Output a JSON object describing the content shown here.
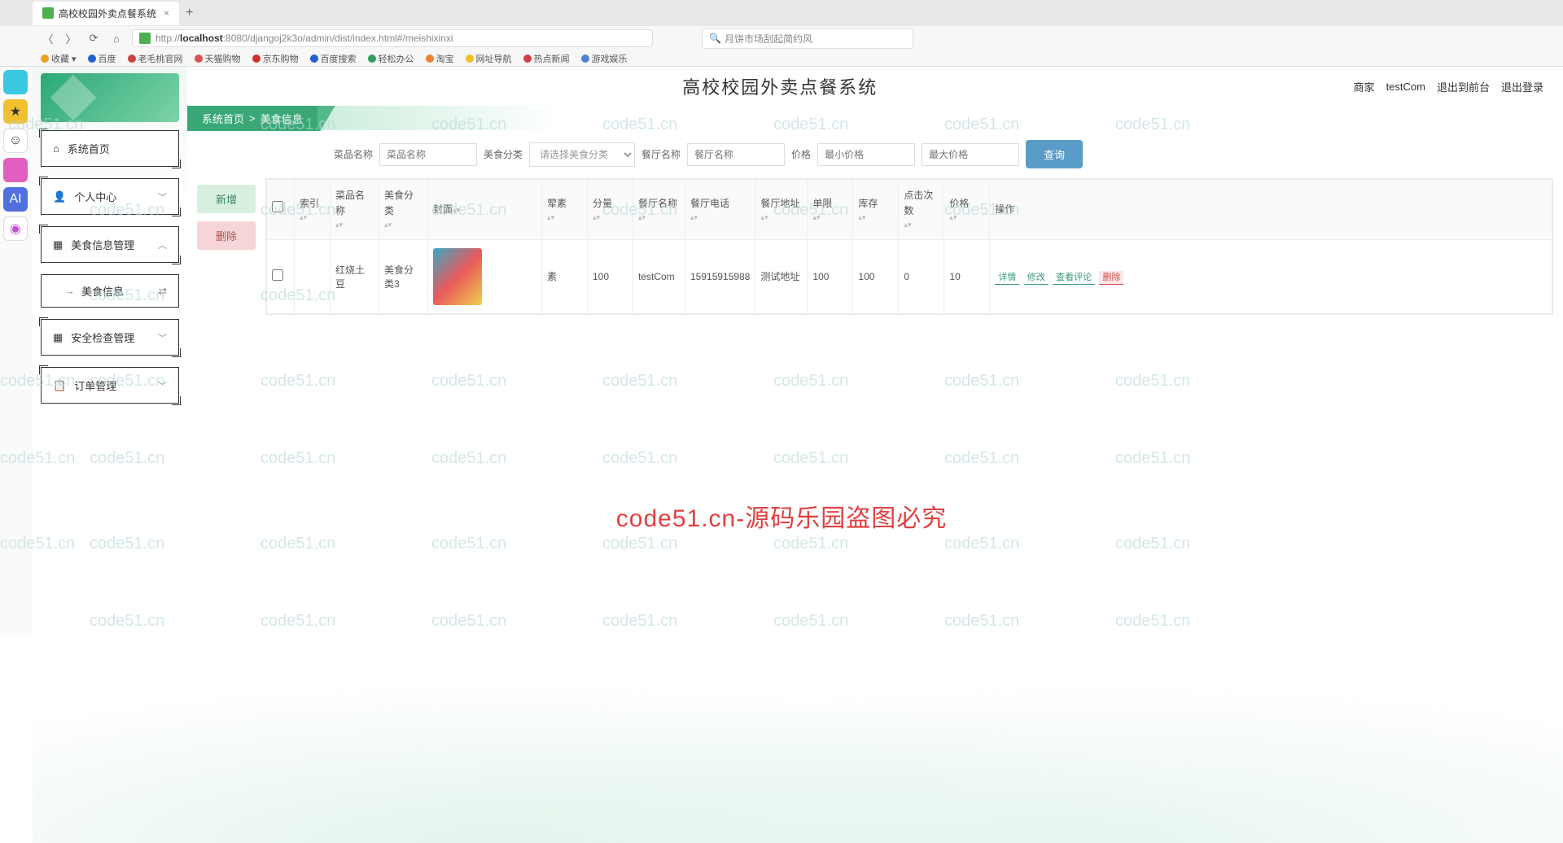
{
  "browser": {
    "tab_title": "高校校园外卖点餐系统",
    "url_prefix": "http://",
    "url_host": "localhost",
    "url_rest": ":8080/djangoj2k3o/admin/dist/index.html#/meishixinxi",
    "search_placeholder": "月饼市场刮起简约风",
    "bookmarks": [
      "收藏",
      "百度",
      "老毛桃官网",
      "天猫购物",
      "京东购物",
      "百度搜索",
      "轻松办公",
      "淘宝",
      "网址导航",
      "热点新闻",
      "游戏娱乐"
    ]
  },
  "header": {
    "title": "高校校园外卖点餐系统",
    "merchant_label": "商家",
    "merchant_name": "testCom",
    "logout_front": "退出到前台",
    "logout": "退出登录"
  },
  "breadcrumb": {
    "home": "系统首页",
    "sep": ">",
    "current": "美食信息"
  },
  "sidebar": {
    "items": [
      {
        "icon": "⌂",
        "label": "系统首页",
        "chev": ""
      },
      {
        "icon": "👤",
        "label": "个人中心",
        "chev": "﹀"
      },
      {
        "icon": "▦",
        "label": "美食信息管理",
        "chev": "︿"
      },
      {
        "icon": "▦",
        "label": "安全检查管理",
        "chev": "﹀"
      },
      {
        "icon": "📋",
        "label": "订单管理",
        "chev": "﹀"
      }
    ],
    "submenu": {
      "label": "美食信息"
    }
  },
  "filters": {
    "name_label": "菜品名称",
    "name_ph": "菜品名称",
    "cat_label": "美食分类",
    "cat_ph": "请选择美食分类",
    "rest_label": "餐厅名称",
    "rest_ph": "餐厅名称",
    "price_label": "价格",
    "min_ph": "最小价格",
    "max_ph": "最大价格",
    "query_btn": "查询"
  },
  "actions": {
    "add": "新增",
    "delete": "删除"
  },
  "table": {
    "headers": [
      "",
      "索引",
      "菜品名称",
      "美食分类",
      "封面",
      "荤素",
      "分量",
      "餐厅名称",
      "餐厅电话",
      "餐厅地址",
      "单限",
      "库存",
      "点击次数",
      "价格",
      "操作"
    ],
    "row": {
      "index": "",
      "name": "红烧土豆",
      "category": "美食分类3",
      "type": "素",
      "portion": "100",
      "restaurant": "testCom",
      "phone": "15915915988",
      "address": "测试地址",
      "limit": "100",
      "stock": "100",
      "clicks": "0",
      "price": "10"
    },
    "ops": {
      "detail": "详情",
      "edit": "修改",
      "comment": "查看评论",
      "delete": "删除"
    }
  },
  "watermark_main": "code51.cn-源码乐园盗图必究",
  "watermark_small": "code51.cn"
}
